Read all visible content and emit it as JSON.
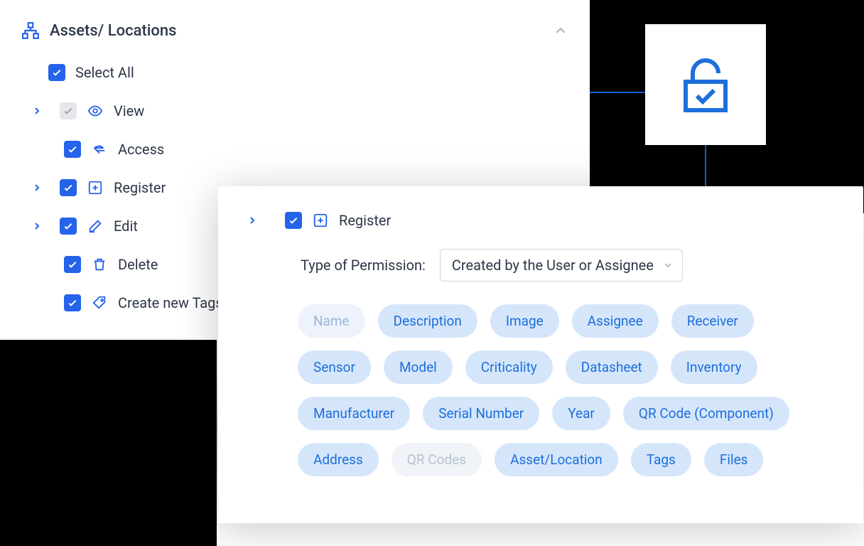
{
  "section": {
    "title": "Assets/ Locations"
  },
  "select_all_label": "Select All",
  "permissions": {
    "view": {
      "label": "View",
      "checked": "partial",
      "expandable": true
    },
    "access": {
      "label": "Access",
      "checked": true
    },
    "register": {
      "label": "Register",
      "checked": true,
      "expandable": true
    },
    "edit": {
      "label": "Edit",
      "checked": true,
      "expandable": true
    },
    "delete": {
      "label": "Delete",
      "checked": true
    },
    "create_tags": {
      "label": "Create new Tags",
      "checked": true
    }
  },
  "detail": {
    "title": "Register",
    "type_label": "Type of Permission:",
    "type_value": "Created by the User or Assignee",
    "chips": [
      {
        "label": "Name",
        "state": "disabled"
      },
      {
        "label": "Description"
      },
      {
        "label": "Image"
      },
      {
        "label": "Assignee"
      },
      {
        "label": "Receiver"
      },
      {
        "label": "Sensor"
      },
      {
        "label": "Model"
      },
      {
        "label": "Criticality"
      },
      {
        "label": "Datasheet"
      },
      {
        "label": "Inventory"
      },
      {
        "label": "Manufacturer"
      },
      {
        "label": "Serial Number"
      },
      {
        "label": "Year"
      },
      {
        "label": "QR Code (Component)"
      },
      {
        "label": "Address"
      },
      {
        "label": "QR Codes",
        "state": "disabled2"
      },
      {
        "label": "Asset/Location"
      },
      {
        "label": "Tags"
      },
      {
        "label": "Files"
      }
    ]
  }
}
